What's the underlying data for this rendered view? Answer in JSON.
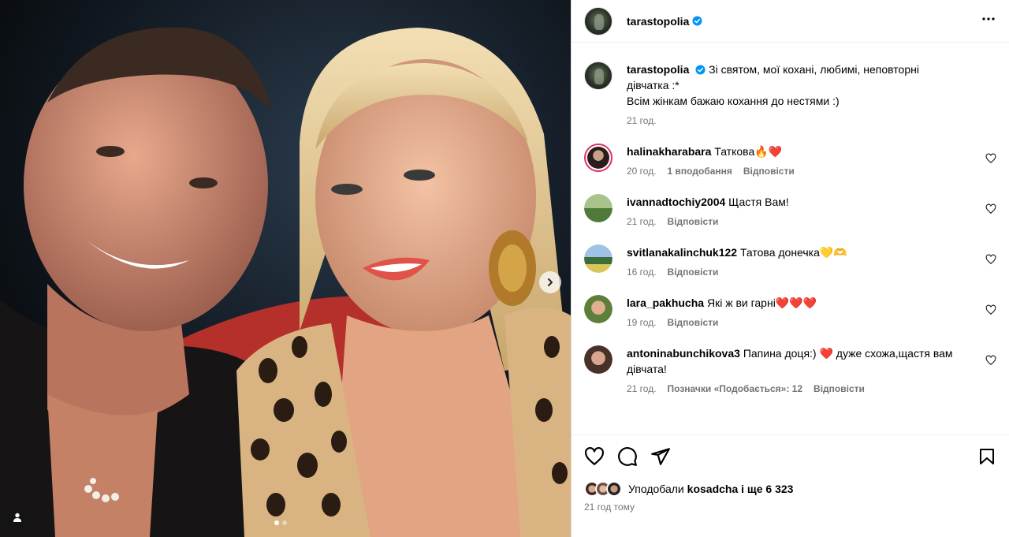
{
  "post": {
    "username": "tarastopolia",
    "caption_line1": "Зі святом, мої кохані, любимі, неповторні дівчатка :*",
    "caption_line2": "Всім жінкам бажаю кохання до нестями :)",
    "caption_time": "21 год."
  },
  "comments": [
    {
      "user": "halinakharabara",
      "text": "Таткова🔥❤️",
      "time": "20 год.",
      "likes": "1 вподобання",
      "reply": "Відповісти"
    },
    {
      "user": "ivannadtochiy2004",
      "text": "Щастя Вам!",
      "time": "21 год.",
      "reply": "Відповісти"
    },
    {
      "user": "svitlanakalinchuk122",
      "text": "Татова донечка💛🫶",
      "time": "16 год.",
      "reply": "Відповісти"
    },
    {
      "user": "lara_pakhucha",
      "text": "Які ж ви гарні❤️❤️❤️",
      "time": "19 год.",
      "reply": "Відповісти"
    },
    {
      "user": "antoninabunchikova3",
      "text": "Папина доця:) ❤️ дуже схожа,щастя вам дівчата!",
      "time": "21 год.",
      "likes": "Позначки «Подобається»: 12",
      "reply": "Відповісти"
    }
  ],
  "footer": {
    "liked_by_prefix": "Уподобали",
    "liked_by_user": "kosadcha",
    "liked_by_and": "і",
    "liked_by_count": "ще 6 323",
    "posted": "21 год тому"
  },
  "icons": {
    "more": "more-horizontal-icon",
    "like": "heart-icon",
    "comment": "comment-bubble-icon",
    "share": "paper-plane-icon",
    "save": "bookmark-icon",
    "next": "chevron-right-icon",
    "tag": "user-tag-icon",
    "verified": "verified-badge-icon"
  },
  "colors": {
    "verified": "#0095f6",
    "secondary_text": "#737373",
    "story_ring": "#e1306c"
  },
  "carousel": {
    "slides": 2,
    "active": 1
  }
}
